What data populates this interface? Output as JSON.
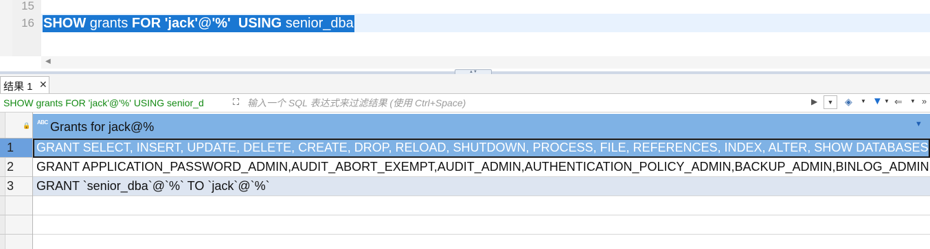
{
  "editor": {
    "lines": [
      {
        "number": "15",
        "code_parts": []
      },
      {
        "number": "16",
        "code_parts": [
          {
            "text": "SHOW",
            "bold": true
          },
          {
            "text": " grants ",
            "bold": false
          },
          {
            "text": "FOR",
            "bold": true
          },
          {
            "text": " ",
            "bold": false
          },
          {
            "text": "'jack'",
            "bold": true
          },
          {
            "text": "@",
            "bold": false
          },
          {
            "text": "'%'",
            "bold": true
          },
          {
            "text": "  ",
            "bold": false
          },
          {
            "text": "USING",
            "bold": true
          },
          {
            "text": " senior_dba",
            "bold": false
          }
        ]
      }
    ],
    "selection_color": "#1a77d2",
    "current_line_color": "#e8f2fe"
  },
  "result_tab": {
    "label": "结果 1",
    "close_glyph": "✕"
  },
  "filter_bar": {
    "query_text": "SHOW grants FOR 'jack'@'%' USING senior_d",
    "placeholder": "输入一个 SQL 表达式来过滤结果 (使用 Ctrl+Space)",
    "icons": [
      "expand-icon",
      "apply-filter-icon",
      "dropdown-icon",
      "eraser-icon",
      "funnel-icon",
      "back-icon"
    ]
  },
  "grid": {
    "column": {
      "type_badge": "ABC",
      "header": "Grants for jack@%"
    },
    "rows": [
      {
        "num": "1",
        "value": "GRANT SELECT, INSERT, UPDATE, DELETE, CREATE, DROP, RELOAD, SHUTDOWN, PROCESS, FILE, REFERENCES, INDEX, ALTER, SHOW DATABASES",
        "state": "selected"
      },
      {
        "num": "2",
        "value": "GRANT APPLICATION_PASSWORD_ADMIN,AUDIT_ABORT_EXEMPT,AUDIT_ADMIN,AUTHENTICATION_POLICY_ADMIN,BACKUP_ADMIN,BINLOG_ADMIN",
        "state": "normal"
      },
      {
        "num": "3",
        "value": "GRANT `senior_dba`@`%` TO `jack`@`%`",
        "state": "alt"
      }
    ],
    "header_color": "#7fb2e5",
    "selected_row_color": "#7fb2e5",
    "alt_row_color": "#dde5f1"
  }
}
